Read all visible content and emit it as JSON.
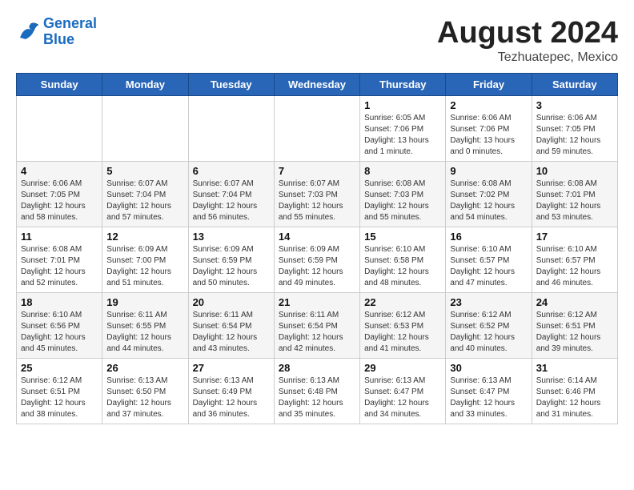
{
  "header": {
    "logo_line1": "General",
    "logo_line2": "Blue",
    "title": "August 2024",
    "subtitle": "Tezhuatepec, Mexico"
  },
  "weekdays": [
    "Sunday",
    "Monday",
    "Tuesday",
    "Wednesday",
    "Thursday",
    "Friday",
    "Saturday"
  ],
  "weeks": [
    [
      {
        "day": "",
        "info": ""
      },
      {
        "day": "",
        "info": ""
      },
      {
        "day": "",
        "info": ""
      },
      {
        "day": "",
        "info": ""
      },
      {
        "day": "1",
        "info": "Sunrise: 6:05 AM\nSunset: 7:06 PM\nDaylight: 13 hours\nand 1 minute."
      },
      {
        "day": "2",
        "info": "Sunrise: 6:06 AM\nSunset: 7:06 PM\nDaylight: 13 hours\nand 0 minutes."
      },
      {
        "day": "3",
        "info": "Sunrise: 6:06 AM\nSunset: 7:05 PM\nDaylight: 12 hours\nand 59 minutes."
      }
    ],
    [
      {
        "day": "4",
        "info": "Sunrise: 6:06 AM\nSunset: 7:05 PM\nDaylight: 12 hours\nand 58 minutes."
      },
      {
        "day": "5",
        "info": "Sunrise: 6:07 AM\nSunset: 7:04 PM\nDaylight: 12 hours\nand 57 minutes."
      },
      {
        "day": "6",
        "info": "Sunrise: 6:07 AM\nSunset: 7:04 PM\nDaylight: 12 hours\nand 56 minutes."
      },
      {
        "day": "7",
        "info": "Sunrise: 6:07 AM\nSunset: 7:03 PM\nDaylight: 12 hours\nand 55 minutes."
      },
      {
        "day": "8",
        "info": "Sunrise: 6:08 AM\nSunset: 7:03 PM\nDaylight: 12 hours\nand 55 minutes."
      },
      {
        "day": "9",
        "info": "Sunrise: 6:08 AM\nSunset: 7:02 PM\nDaylight: 12 hours\nand 54 minutes."
      },
      {
        "day": "10",
        "info": "Sunrise: 6:08 AM\nSunset: 7:01 PM\nDaylight: 12 hours\nand 53 minutes."
      }
    ],
    [
      {
        "day": "11",
        "info": "Sunrise: 6:08 AM\nSunset: 7:01 PM\nDaylight: 12 hours\nand 52 minutes."
      },
      {
        "day": "12",
        "info": "Sunrise: 6:09 AM\nSunset: 7:00 PM\nDaylight: 12 hours\nand 51 minutes."
      },
      {
        "day": "13",
        "info": "Sunrise: 6:09 AM\nSunset: 6:59 PM\nDaylight: 12 hours\nand 50 minutes."
      },
      {
        "day": "14",
        "info": "Sunrise: 6:09 AM\nSunset: 6:59 PM\nDaylight: 12 hours\nand 49 minutes."
      },
      {
        "day": "15",
        "info": "Sunrise: 6:10 AM\nSunset: 6:58 PM\nDaylight: 12 hours\nand 48 minutes."
      },
      {
        "day": "16",
        "info": "Sunrise: 6:10 AM\nSunset: 6:57 PM\nDaylight: 12 hours\nand 47 minutes."
      },
      {
        "day": "17",
        "info": "Sunrise: 6:10 AM\nSunset: 6:57 PM\nDaylight: 12 hours\nand 46 minutes."
      }
    ],
    [
      {
        "day": "18",
        "info": "Sunrise: 6:10 AM\nSunset: 6:56 PM\nDaylight: 12 hours\nand 45 minutes."
      },
      {
        "day": "19",
        "info": "Sunrise: 6:11 AM\nSunset: 6:55 PM\nDaylight: 12 hours\nand 44 minutes."
      },
      {
        "day": "20",
        "info": "Sunrise: 6:11 AM\nSunset: 6:54 PM\nDaylight: 12 hours\nand 43 minutes."
      },
      {
        "day": "21",
        "info": "Sunrise: 6:11 AM\nSunset: 6:54 PM\nDaylight: 12 hours\nand 42 minutes."
      },
      {
        "day": "22",
        "info": "Sunrise: 6:12 AM\nSunset: 6:53 PM\nDaylight: 12 hours\nand 41 minutes."
      },
      {
        "day": "23",
        "info": "Sunrise: 6:12 AM\nSunset: 6:52 PM\nDaylight: 12 hours\nand 40 minutes."
      },
      {
        "day": "24",
        "info": "Sunrise: 6:12 AM\nSunset: 6:51 PM\nDaylight: 12 hours\nand 39 minutes."
      }
    ],
    [
      {
        "day": "25",
        "info": "Sunrise: 6:12 AM\nSunset: 6:51 PM\nDaylight: 12 hours\nand 38 minutes."
      },
      {
        "day": "26",
        "info": "Sunrise: 6:13 AM\nSunset: 6:50 PM\nDaylight: 12 hours\nand 37 minutes."
      },
      {
        "day": "27",
        "info": "Sunrise: 6:13 AM\nSunset: 6:49 PM\nDaylight: 12 hours\nand 36 minutes."
      },
      {
        "day": "28",
        "info": "Sunrise: 6:13 AM\nSunset: 6:48 PM\nDaylight: 12 hours\nand 35 minutes."
      },
      {
        "day": "29",
        "info": "Sunrise: 6:13 AM\nSunset: 6:47 PM\nDaylight: 12 hours\nand 34 minutes."
      },
      {
        "day": "30",
        "info": "Sunrise: 6:13 AM\nSunset: 6:47 PM\nDaylight: 12 hours\nand 33 minutes."
      },
      {
        "day": "31",
        "info": "Sunrise: 6:14 AM\nSunset: 6:46 PM\nDaylight: 12 hours\nand 31 minutes."
      }
    ]
  ]
}
